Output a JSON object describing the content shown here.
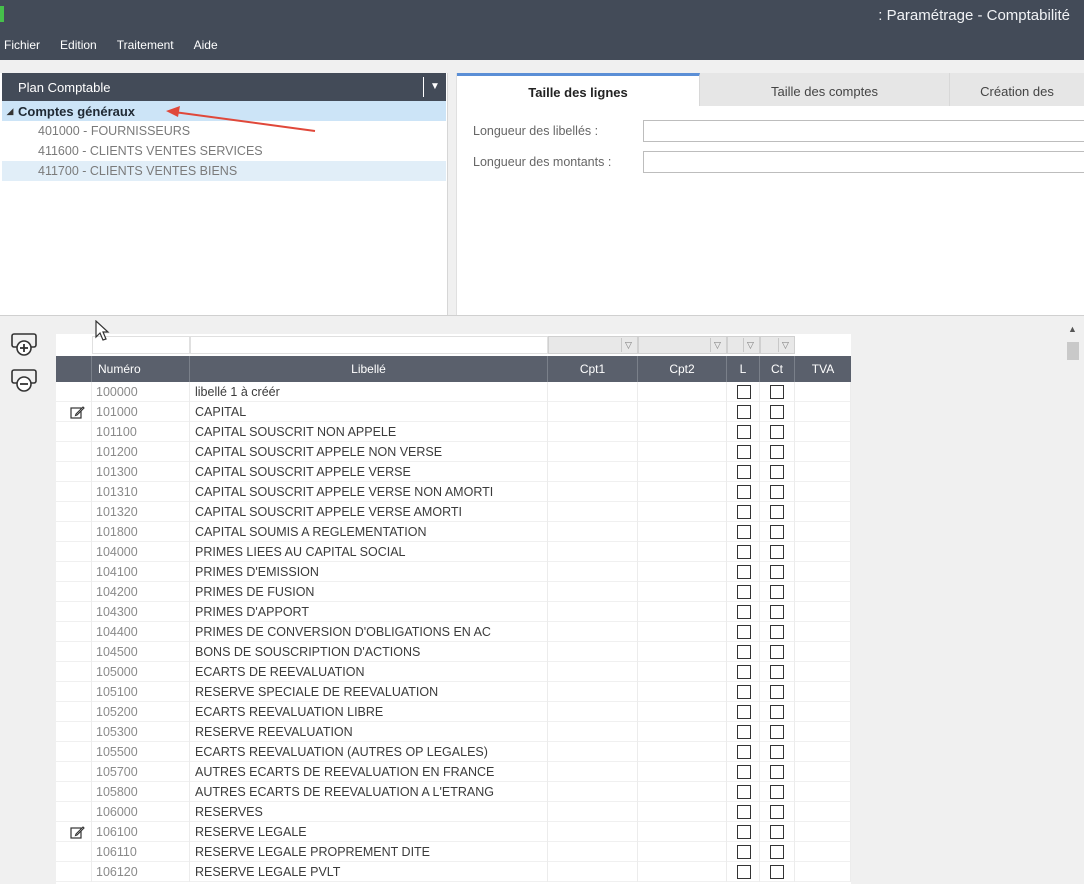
{
  "window": {
    "title": ": Paramétrage - Comptabilité"
  },
  "menu": [
    "Fichier",
    "Edition",
    "Traitement",
    "Aide"
  ],
  "tree": {
    "header": "Plan Comptable",
    "root": "Comptes généraux",
    "children": [
      "401000 - FOURNISSEURS",
      "411600 - CLIENTS VENTES SERVICES",
      "411700 - CLIENTS VENTES BIENS"
    ],
    "selected_index": 2
  },
  "tabs": [
    {
      "label": "Taille des lignes",
      "active": true
    },
    {
      "label": "Taille des comptes",
      "active": false
    },
    {
      "label": "Création des",
      "active": false
    }
  ],
  "fields": [
    {
      "label": "Longueur des libellés :",
      "value": ""
    },
    {
      "label": "Longueur des montants :",
      "value": ""
    }
  ],
  "grid": {
    "columns": [
      "Numéro",
      "Libellé",
      "Cpt1",
      "Cpt2",
      "L",
      "Ct",
      "TVA"
    ],
    "rows": [
      {
        "num": "100000",
        "lib": "libellé 1 à créér",
        "edit": false
      },
      {
        "num": "101000",
        "lib": "CAPITAL",
        "edit": true
      },
      {
        "num": "101100",
        "lib": "CAPITAL SOUSCRIT NON APPELE",
        "edit": false
      },
      {
        "num": "101200",
        "lib": "CAPITAL SOUSCRIT APPELE NON VERSE",
        "edit": false
      },
      {
        "num": "101300",
        "lib": "CAPITAL SOUSCRIT APPELE VERSE",
        "edit": false
      },
      {
        "num": "101310",
        "lib": "CAPITAL SOUSCRIT APPELE VERSE NON AMORTI",
        "edit": false
      },
      {
        "num": "101320",
        "lib": "CAPITAL SOUSCRIT APPELE VERSE AMORTI",
        "edit": false
      },
      {
        "num": "101800",
        "lib": "CAPITAL SOUMIS A REGLEMENTATION",
        "edit": false
      },
      {
        "num": "104000",
        "lib": "PRIMES LIEES AU CAPITAL SOCIAL",
        "edit": false
      },
      {
        "num": "104100",
        "lib": "PRIMES D'EMISSION",
        "edit": false
      },
      {
        "num": "104200",
        "lib": "PRIMES DE FUSION",
        "edit": false
      },
      {
        "num": "104300",
        "lib": "PRIMES D'APPORT",
        "edit": false
      },
      {
        "num": "104400",
        "lib": "PRIMES DE CONVERSION D'OBLIGATIONS EN AC",
        "edit": false
      },
      {
        "num": "104500",
        "lib": "BONS DE SOUSCRIPTION D'ACTIONS",
        "edit": false
      },
      {
        "num": "105000",
        "lib": "ECARTS DE REEVALUATION",
        "edit": false
      },
      {
        "num": "105100",
        "lib": "RESERVE SPECIALE DE REEVALUATION",
        "edit": false
      },
      {
        "num": "105200",
        "lib": "ECARTS REEVALUATION LIBRE",
        "edit": false
      },
      {
        "num": "105300",
        "lib": "RESERVE REEVALUATION",
        "edit": false
      },
      {
        "num": "105500",
        "lib": "ECARTS REEVALUATION (AUTRES OP LEGALES)",
        "edit": false
      },
      {
        "num": "105700",
        "lib": "AUTRES ECARTS DE REEVALUATION EN FRANCE",
        "edit": false
      },
      {
        "num": "105800",
        "lib": "AUTRES ECARTS DE REEVALUATION A L'ETRANG",
        "edit": false
      },
      {
        "num": "106000",
        "lib": "RESERVES",
        "edit": false
      },
      {
        "num": "106100",
        "lib": "RESERVE LEGALE",
        "edit": true
      },
      {
        "num": "106110",
        "lib": "RESERVE LEGALE PROPREMENT DITE",
        "edit": false
      },
      {
        "num": "106120",
        "lib": "RESERVE LEGALE PVLT",
        "edit": false
      }
    ]
  },
  "icons": {
    "add_row": "add-row-icon",
    "remove_row": "remove-row-icon",
    "edit": "pencil-icon",
    "cursor": "mouse-cursor-icon"
  },
  "colors": {
    "titlebar": "#434b58",
    "grid_header": "#5a606c",
    "selection": "#cce4f7",
    "annotation": "#e0483a",
    "accent_tab": "#5b8fd6"
  }
}
